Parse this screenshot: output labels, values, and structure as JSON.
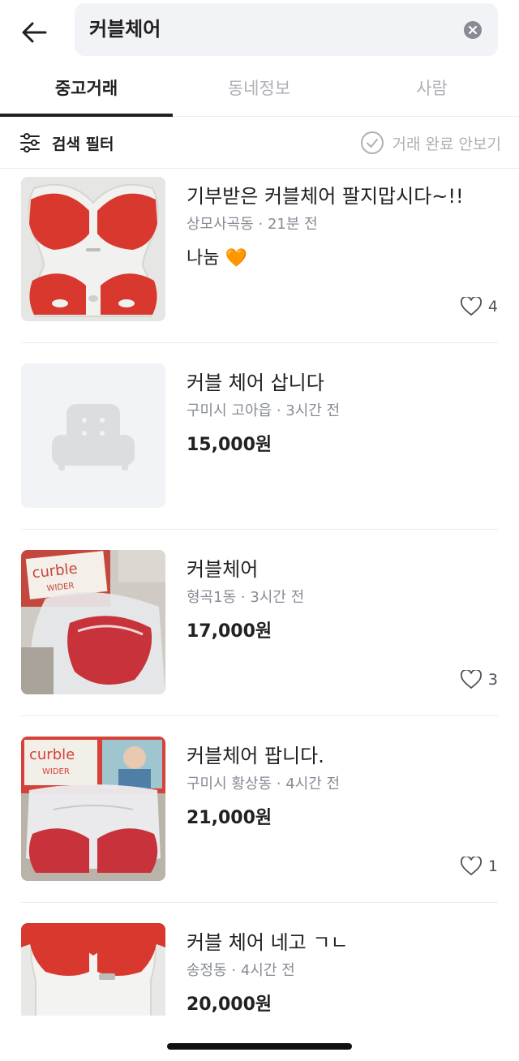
{
  "search": {
    "query": "커블체어"
  },
  "tabs": [
    {
      "label": "중고거래",
      "active": true
    },
    {
      "label": "동네정보",
      "active": false
    },
    {
      "label": "사람",
      "active": false
    }
  ],
  "filter": {
    "label": "검색 필터",
    "hide_done_label": "거래 완료 안보기"
  },
  "items": [
    {
      "title": "기부받은 커블체어 팔지맙시다~!!",
      "location": "상모사곡동",
      "time": "21분 전",
      "price": "나눔 🧡",
      "likes": "4",
      "thumb": "red-seat-photo"
    },
    {
      "title": "커블 체어 삽니다",
      "location": "구미시 고아읍",
      "time": "3시간 전",
      "price": "15,000원",
      "likes": "",
      "thumb": "placeholder-chair"
    },
    {
      "title": "커블체어",
      "location": "형곡1동",
      "time": "3시간 전",
      "price": "17,000원",
      "likes": "3",
      "thumb": "boxed-seat-photo"
    },
    {
      "title": "커블체어 팝니다.",
      "location": "구미시 황상동",
      "time": "4시간 전",
      "price": "21,000원",
      "likes": "1",
      "thumb": "boxed-seat-photo"
    },
    {
      "title": "커블 체어 네고 ㄱㄴ",
      "location": "송정동",
      "time": "4시간 전",
      "price": "20,000원",
      "likes": "",
      "thumb": "red-seat-photo"
    }
  ],
  "colors": {
    "text": "#212124",
    "muted": "#868b94",
    "disabled": "#aeb0b5",
    "seat_red": "#d8382e",
    "divider": "#e9ecef"
  }
}
